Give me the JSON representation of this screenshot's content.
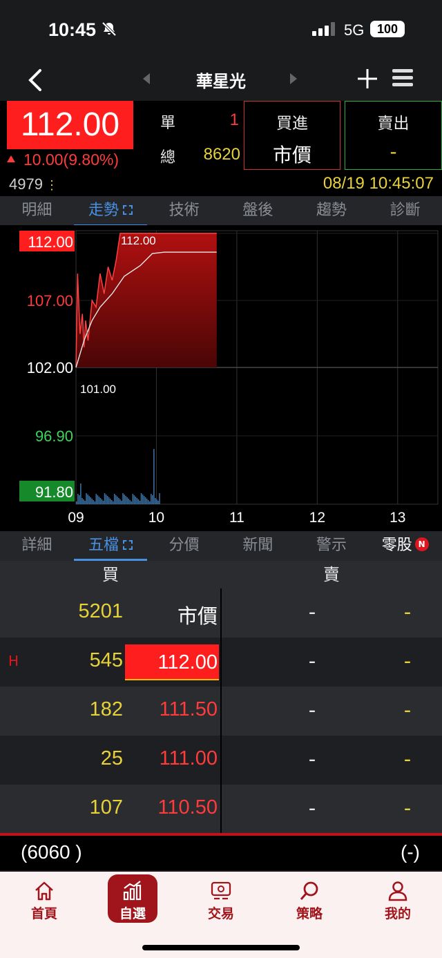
{
  "status": {
    "time": "10:45",
    "network": "5G",
    "battery": "100"
  },
  "nav": {
    "title": "華星光"
  },
  "quote": {
    "price": "112.00",
    "change": "10.00(9.80%)",
    "single_label": "單",
    "single_value": "1",
    "total_label": "總",
    "total_value": "8620",
    "buy_label": "買進",
    "buy_value": "市價",
    "sell_label": "賣出",
    "sell_value": "-",
    "volume_code": "4979",
    "datetime": "08/19 10:45:07"
  },
  "tabs_top": [
    "明細",
    "走勢",
    "技術",
    "盤後",
    "趨勢",
    "診斷"
  ],
  "chart_data": {
    "type": "line",
    "y_ticks": [
      "112.00",
      "107.00",
      "102.00",
      "96.90",
      "91.80"
    ],
    "x_ticks": [
      "09",
      "10",
      "11",
      "12",
      "13"
    ],
    "high_label": "112.00",
    "low_label": "101.00",
    "reference": 102.0,
    "ylim": [
      91.8,
      112.2
    ],
    "price_series": [
      [
        9.0,
        102.0
      ],
      [
        9.02,
        109.0
      ],
      [
        9.05,
        104.5
      ],
      [
        9.08,
        106.0
      ],
      [
        9.1,
        103.5
      ],
      [
        9.12,
        105.5
      ],
      [
        9.15,
        104.0
      ],
      [
        9.2,
        107.0
      ],
      [
        9.25,
        106.5
      ],
      [
        9.3,
        109.0
      ],
      [
        9.35,
        107.5
      ],
      [
        9.4,
        109.5
      ],
      [
        9.45,
        108.5
      ],
      [
        9.5,
        110.0
      ],
      [
        9.55,
        112.0
      ],
      [
        9.7,
        112.0
      ],
      [
        9.8,
        112.0
      ],
      [
        10.0,
        112.0
      ],
      [
        10.5,
        112.0
      ],
      [
        10.75,
        112.0
      ]
    ],
    "avg_series": [
      [
        9.0,
        102.0
      ],
      [
        9.1,
        104.0
      ],
      [
        9.2,
        105.5
      ],
      [
        9.3,
        106.5
      ],
      [
        9.45,
        107.5
      ],
      [
        9.6,
        108.8
      ],
      [
        9.8,
        109.6
      ],
      [
        9.95,
        110.5
      ],
      [
        10.1,
        110.6
      ],
      [
        10.5,
        110.6
      ],
      [
        10.75,
        110.6
      ]
    ]
  },
  "tabs_mid": [
    "詳細",
    "五檔",
    "分價",
    "新聞",
    "警示",
    "零股"
  ],
  "tabs_mid_badge": "N",
  "book": {
    "buy_header": "買",
    "sell_header": "賣",
    "rows": [
      {
        "flag": "",
        "bid_qty": "5201",
        "bid_price": "市價",
        "ask_price": "-",
        "ask_qty": "-"
      },
      {
        "flag": "H",
        "bid_qty": "545",
        "bid_price": "112.00",
        "ask_price": "-",
        "ask_qty": "-"
      },
      {
        "flag": "",
        "bid_qty": "182",
        "bid_price": "111.50",
        "ask_price": "-",
        "ask_qty": "-"
      },
      {
        "flag": "",
        "bid_qty": "25",
        "bid_price": "111.00",
        "ask_price": "-",
        "ask_qty": "-"
      },
      {
        "flag": "",
        "bid_qty": "107",
        "bid_price": "110.50",
        "ask_price": "-",
        "ask_qty": "-"
      }
    ],
    "bid_total": "(6060 )",
    "ask_total": "(-)"
  },
  "bottom_nav": [
    "首頁",
    "自選",
    "交易",
    "策略",
    "我的"
  ],
  "colors": {
    "up": "#ff1e1e",
    "down": "#2fae3f",
    "accent": "#4a90e2",
    "brand": "#a0151b"
  }
}
